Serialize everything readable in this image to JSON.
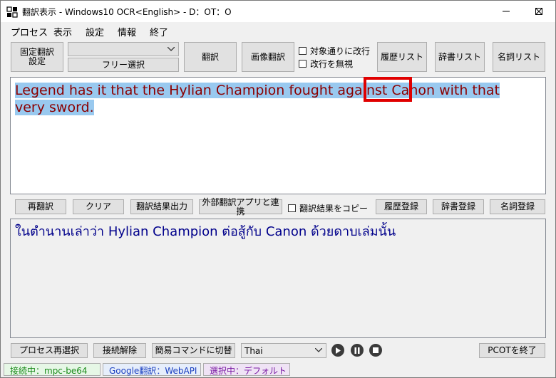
{
  "window": {
    "title": "翻訳表示 - Windows10 OCR<English> - D：OT：O"
  },
  "menu": [
    "プロセス",
    "表示",
    "設定",
    "情報",
    "終了"
  ],
  "toolbar": {
    "fixed_translation_settings": "固定翻訳\n設定",
    "free_select": "フリー選択",
    "translate": "翻訳",
    "image_translate": "画像翻訳",
    "newline_as_target": "対象通りに改行",
    "ignore_newline": "改行を無視",
    "history_list": "履歴リスト",
    "dictionary_list": "辞書リスト",
    "noun_list": "名詞リスト"
  },
  "source": {
    "before": "Legend has it that the Hylian Champion fought against ",
    "highlight_word": "Canon",
    "after": " with that very sword."
  },
  "actions": {
    "retranslate": "再翻訳",
    "clear": "クリア",
    "export_result": "翻訳結果出力",
    "external_app": "外部翻訳アプリと連携",
    "copy_result": "翻訳結果をコピー",
    "register_history": "履歴登録",
    "register_dictionary": "辞書登録",
    "register_noun": "名詞登録"
  },
  "output": {
    "text": "ในตำนานเล่าว่า Hylian Champion ต่อสู้กับ Canon ด้วยดาบเล่มนั้น"
  },
  "bottom": {
    "reselect_process": "プロセス再選択",
    "disconnect": "接続解除",
    "simple_command": "簡易コマンドに切替",
    "language": "Thai",
    "quit_pcot": "PCOTを終了"
  },
  "status": {
    "connection": "接続中：mpc-be64",
    "engine": "Google翻訳：WebAPI",
    "selection": "選択中：デフォルト"
  },
  "colors": {
    "source_text": "#8b0000",
    "output_text": "#00008b",
    "highlight": "#99c9ef",
    "red_box": "#e00000"
  }
}
